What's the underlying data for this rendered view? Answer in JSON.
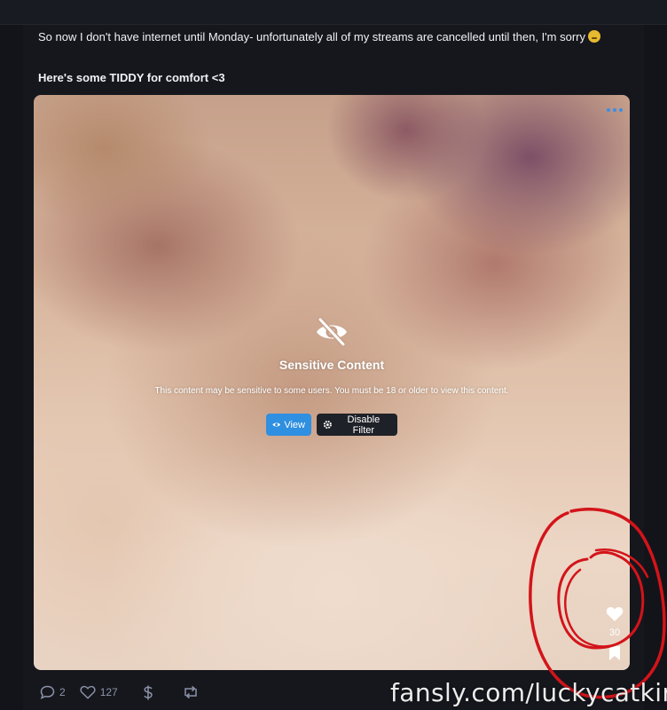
{
  "post": {
    "text_line1": "So now I don't have internet until Monday- unfortunately all of my streams are cancelled until then, I'm sorry",
    "text_line2": "Here's some TIDDY for comfort <3"
  },
  "sensitive": {
    "title": "Sensitive Content",
    "description": "This content may be sensitive to some users. You must be 18 or older to view this content.",
    "view_label": "View",
    "disable_label": "Disable Filter"
  },
  "media": {
    "like_count": "30"
  },
  "actions": {
    "comments": "2",
    "likes": "127"
  },
  "watermark": "fansly.com/luckycatkira",
  "colors": {
    "accent": "#2f8fe0",
    "annotation": "#d3141a",
    "background": "#131419"
  },
  "icons": [
    "menu-dots-icon",
    "eye-slash-icon",
    "eye-icon",
    "gear-icon",
    "heart-icon",
    "bookmark-icon",
    "comment-icon",
    "dollar-icon",
    "repost-icon"
  ]
}
